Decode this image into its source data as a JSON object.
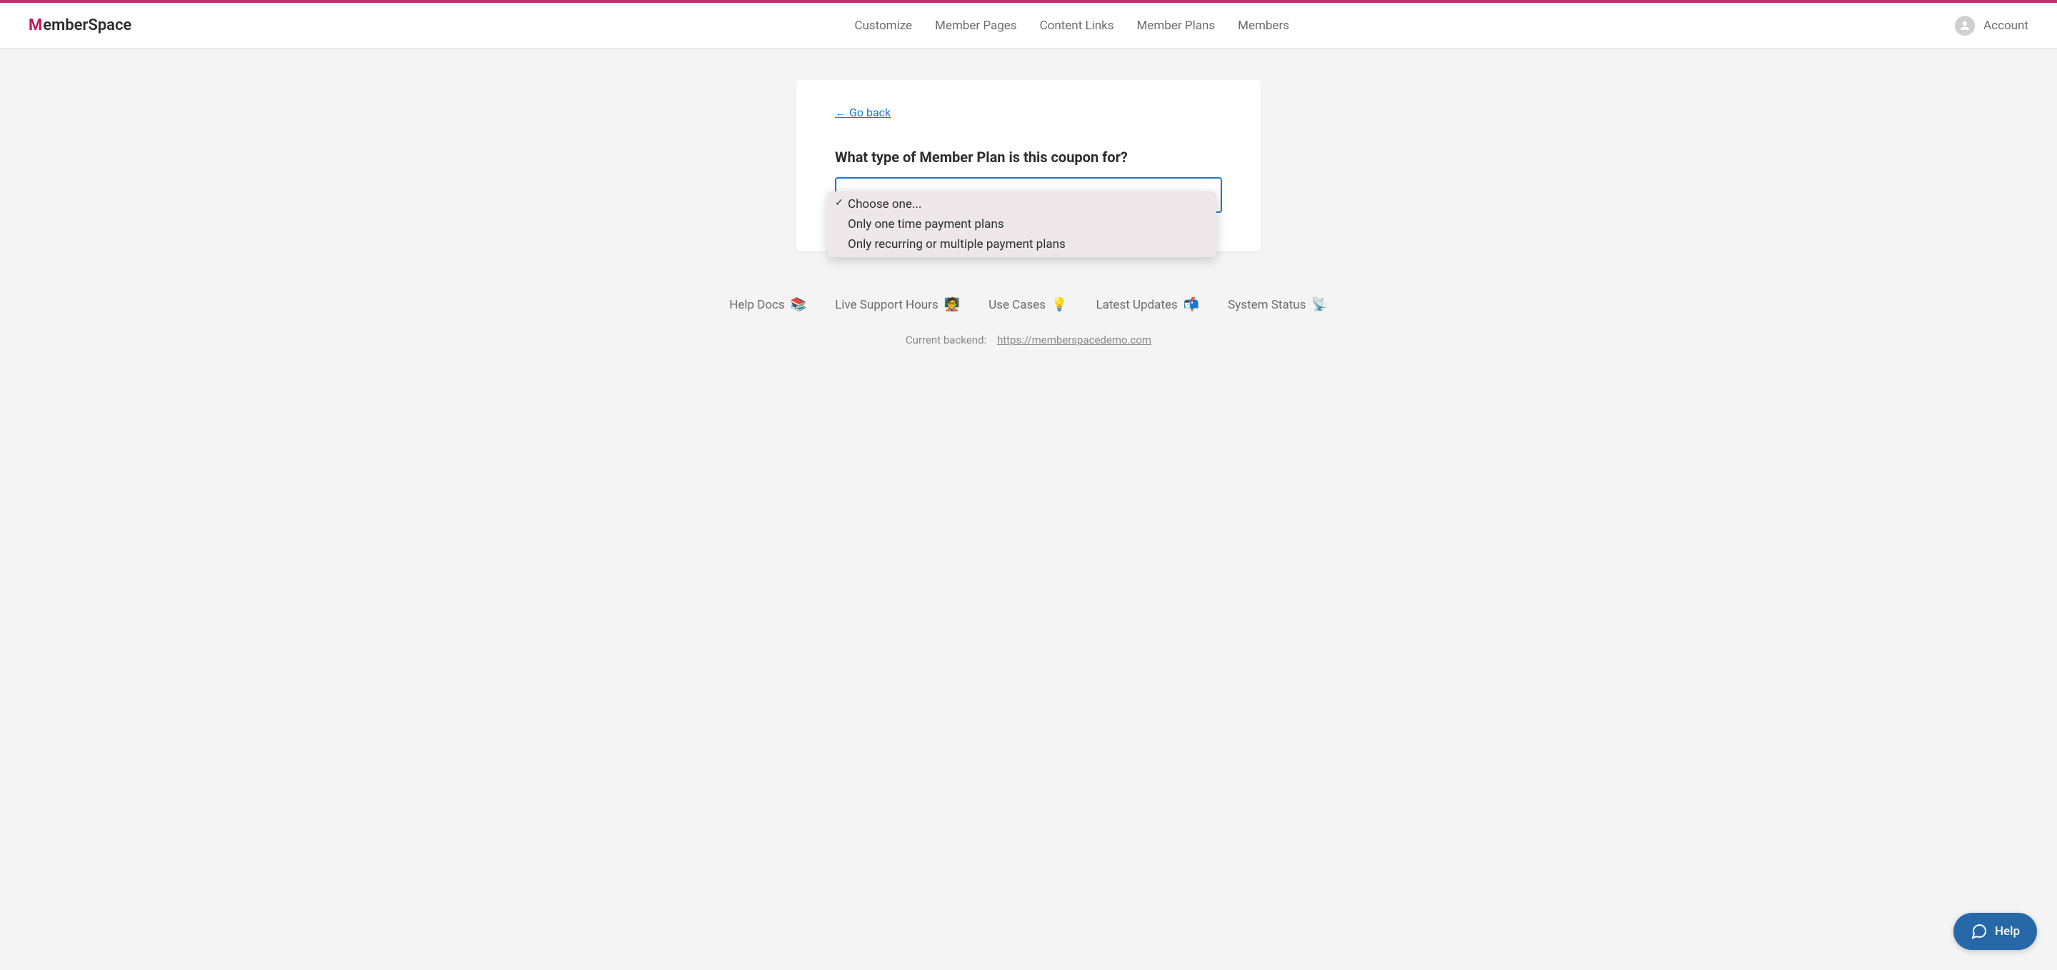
{
  "logo": {
    "prefix": "M",
    "text": "emberSpace"
  },
  "nav": {
    "items": [
      {
        "label": "Customize"
      },
      {
        "label": "Member Pages"
      },
      {
        "label": "Content Links"
      },
      {
        "label": "Member Plans"
      },
      {
        "label": "Members"
      }
    ]
  },
  "account": {
    "label": "Account"
  },
  "card": {
    "go_back": "← Go back",
    "question": "What type of Member Plan is this coupon for?"
  },
  "dropdown": {
    "options": [
      {
        "label": "Choose one...",
        "selected": true
      },
      {
        "label": "Only one time payment plans",
        "selected": false
      },
      {
        "label": "Only recurring or multiple payment plans",
        "selected": false
      }
    ]
  },
  "footer": {
    "links": [
      {
        "label": "Help Docs",
        "emoji": "📚"
      },
      {
        "label": "Live Support Hours",
        "emoji": "🧑‍🏫"
      },
      {
        "label": "Use Cases",
        "emoji": "💡"
      },
      {
        "label": "Latest Updates",
        "emoji": "📬"
      },
      {
        "label": "System Status",
        "emoji": "📡"
      }
    ],
    "backend_label": "Current backend:",
    "backend_url": "https://memberspacedemo.com"
  },
  "help": {
    "label": "Help"
  }
}
